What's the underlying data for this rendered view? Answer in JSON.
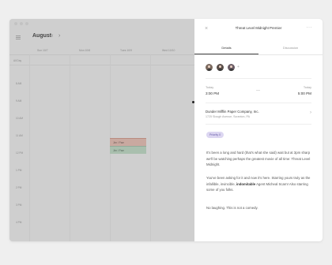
{
  "calendar": {
    "month": "August",
    "prev_icon": "‹",
    "next_icon": "›",
    "days": [
      "Sun 10/7",
      "Mon 10/8",
      "Tues 10/9",
      "Wed 10/10"
    ],
    "allday_label": "All Day",
    "hours": [
      "8 AM",
      "9 AM",
      "10 AM",
      "11 AM",
      "12 PM",
      "1 PM",
      "2 PM",
      "3 PM",
      "4 PM"
    ],
    "events": [
      {
        "label": "Jim / Pam",
        "color": "#c9a9a0"
      },
      {
        "label": "Jim / Pam",
        "color": "#a9bfae"
      }
    ]
  },
  "panel": {
    "title": "Threat Level Midnight Premier",
    "close_icon": "×",
    "more_icon": "···",
    "tabs": [
      "Details",
      "Discussion"
    ],
    "add_attendee": "+",
    "start": {
      "day": "Today",
      "time": "3:00 PM"
    },
    "separator": "—",
    "end": {
      "day": "Today",
      "time": "5:00 PM"
    },
    "location": {
      "name": "Dunder Mifflin Paper Company, Inc.",
      "address": "1725 Slough Avenue, Scranton, PA",
      "chevron": "›"
    },
    "priority": "Priority 0",
    "description": {
      "p1": "It's been a long and hard (that's what she said) wait but at 3pm sharp we'll be watching perhaps the greatest movie of all time: Threat Level Midnight.",
      "p2_before": "You've been asking for it and now it's here. Starring yours truly as the infallible, invincible, ",
      "p2_bold": "indomitable",
      "p2_after": " Agent Micheal Scarn! Also starring some of you folks.",
      "p3": "No laughing. This is not a comedy."
    }
  },
  "colors": {
    "accent_badge": "#dcd6f1",
    "overlay": "#cfcfcf"
  }
}
